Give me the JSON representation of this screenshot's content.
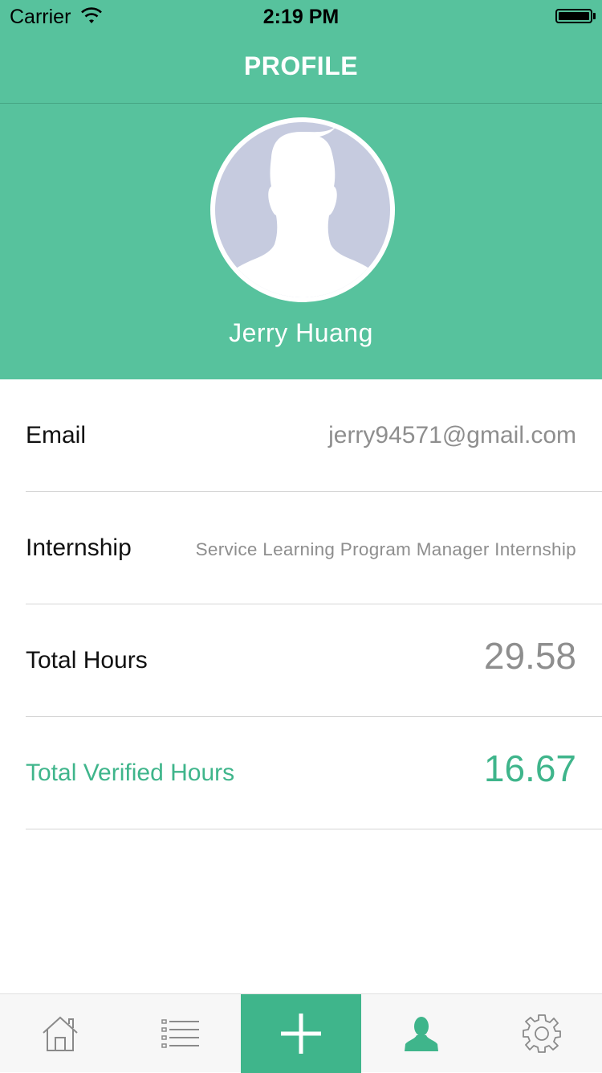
{
  "status_bar": {
    "carrier": "Carrier",
    "time": "2:19 PM"
  },
  "nav": {
    "title": "PROFILE"
  },
  "profile": {
    "name": "Jerry Huang"
  },
  "fields": [
    {
      "label": "Email",
      "value": "jerry94571@gmail.com"
    },
    {
      "label": "Internship",
      "value": "Service Learning Program Manager Internship"
    },
    {
      "label": "Total Hours",
      "value": "29.58"
    },
    {
      "label": "Total Verified Hours",
      "value": "16.67"
    }
  ],
  "tab_bar": {
    "tabs": [
      {
        "icon": "home-icon"
      },
      {
        "icon": "list-icon"
      },
      {
        "icon": "plus-icon"
      },
      {
        "icon": "person-icon"
      },
      {
        "icon": "gear-icon"
      }
    ],
    "active_color": "#3fb58b",
    "inactive_color": "#8a8a8a"
  },
  "colors": {
    "accent": "#57c29d",
    "green_text": "#3fb58b",
    "avatar_bg": "#c6cbdf"
  }
}
